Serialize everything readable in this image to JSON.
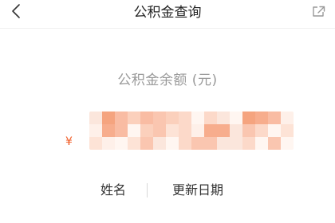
{
  "nav": {
    "title": "公积金查询",
    "back_icon": "chevron-left-icon",
    "share_icon": "share-icon"
  },
  "balance": {
    "label": "公积金余额 (元)",
    "currency": "¥",
    "amount_state": "pixelated-hidden"
  },
  "info": {
    "name_label": "姓名",
    "update_label": "更新日期"
  },
  "colors": {
    "accent": "#f05a23",
    "muted": "#999999",
    "text": "#333333"
  }
}
